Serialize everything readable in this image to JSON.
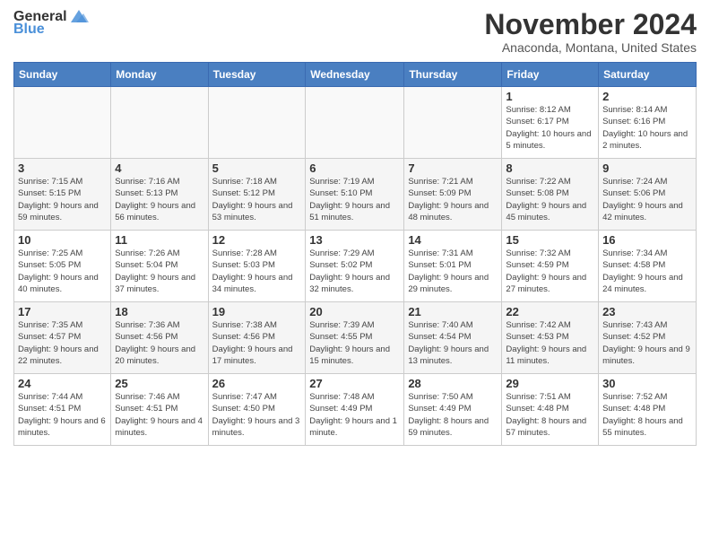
{
  "header": {
    "logo_general": "General",
    "logo_blue": "Blue",
    "month_title": "November 2024",
    "location": "Anaconda, Montana, United States"
  },
  "weekdays": [
    "Sunday",
    "Monday",
    "Tuesday",
    "Wednesday",
    "Thursday",
    "Friday",
    "Saturday"
  ],
  "rows": [
    [
      {
        "day": "",
        "info": ""
      },
      {
        "day": "",
        "info": ""
      },
      {
        "day": "",
        "info": ""
      },
      {
        "day": "",
        "info": ""
      },
      {
        "day": "",
        "info": ""
      },
      {
        "day": "1",
        "info": "Sunrise: 8:12 AM\nSunset: 6:17 PM\nDaylight: 10 hours\nand 5 minutes."
      },
      {
        "day": "2",
        "info": "Sunrise: 8:14 AM\nSunset: 6:16 PM\nDaylight: 10 hours\nand 2 minutes."
      }
    ],
    [
      {
        "day": "3",
        "info": "Sunrise: 7:15 AM\nSunset: 5:15 PM\nDaylight: 9 hours\nand 59 minutes."
      },
      {
        "day": "4",
        "info": "Sunrise: 7:16 AM\nSunset: 5:13 PM\nDaylight: 9 hours\nand 56 minutes."
      },
      {
        "day": "5",
        "info": "Sunrise: 7:18 AM\nSunset: 5:12 PM\nDaylight: 9 hours\nand 53 minutes."
      },
      {
        "day": "6",
        "info": "Sunrise: 7:19 AM\nSunset: 5:10 PM\nDaylight: 9 hours\nand 51 minutes."
      },
      {
        "day": "7",
        "info": "Sunrise: 7:21 AM\nSunset: 5:09 PM\nDaylight: 9 hours\nand 48 minutes."
      },
      {
        "day": "8",
        "info": "Sunrise: 7:22 AM\nSunset: 5:08 PM\nDaylight: 9 hours\nand 45 minutes."
      },
      {
        "day": "9",
        "info": "Sunrise: 7:24 AM\nSunset: 5:06 PM\nDaylight: 9 hours\nand 42 minutes."
      }
    ],
    [
      {
        "day": "10",
        "info": "Sunrise: 7:25 AM\nSunset: 5:05 PM\nDaylight: 9 hours\nand 40 minutes."
      },
      {
        "day": "11",
        "info": "Sunrise: 7:26 AM\nSunset: 5:04 PM\nDaylight: 9 hours\nand 37 minutes."
      },
      {
        "day": "12",
        "info": "Sunrise: 7:28 AM\nSunset: 5:03 PM\nDaylight: 9 hours\nand 34 minutes."
      },
      {
        "day": "13",
        "info": "Sunrise: 7:29 AM\nSunset: 5:02 PM\nDaylight: 9 hours\nand 32 minutes."
      },
      {
        "day": "14",
        "info": "Sunrise: 7:31 AM\nSunset: 5:01 PM\nDaylight: 9 hours\nand 29 minutes."
      },
      {
        "day": "15",
        "info": "Sunrise: 7:32 AM\nSunset: 4:59 PM\nDaylight: 9 hours\nand 27 minutes."
      },
      {
        "day": "16",
        "info": "Sunrise: 7:34 AM\nSunset: 4:58 PM\nDaylight: 9 hours\nand 24 minutes."
      }
    ],
    [
      {
        "day": "17",
        "info": "Sunrise: 7:35 AM\nSunset: 4:57 PM\nDaylight: 9 hours\nand 22 minutes."
      },
      {
        "day": "18",
        "info": "Sunrise: 7:36 AM\nSunset: 4:56 PM\nDaylight: 9 hours\nand 20 minutes."
      },
      {
        "day": "19",
        "info": "Sunrise: 7:38 AM\nSunset: 4:56 PM\nDaylight: 9 hours\nand 17 minutes."
      },
      {
        "day": "20",
        "info": "Sunrise: 7:39 AM\nSunset: 4:55 PM\nDaylight: 9 hours\nand 15 minutes."
      },
      {
        "day": "21",
        "info": "Sunrise: 7:40 AM\nSunset: 4:54 PM\nDaylight: 9 hours\nand 13 minutes."
      },
      {
        "day": "22",
        "info": "Sunrise: 7:42 AM\nSunset: 4:53 PM\nDaylight: 9 hours\nand 11 minutes."
      },
      {
        "day": "23",
        "info": "Sunrise: 7:43 AM\nSunset: 4:52 PM\nDaylight: 9 hours\nand 9 minutes."
      }
    ],
    [
      {
        "day": "24",
        "info": "Sunrise: 7:44 AM\nSunset: 4:51 PM\nDaylight: 9 hours\nand 6 minutes."
      },
      {
        "day": "25",
        "info": "Sunrise: 7:46 AM\nSunset: 4:51 PM\nDaylight: 9 hours\nand 4 minutes."
      },
      {
        "day": "26",
        "info": "Sunrise: 7:47 AM\nSunset: 4:50 PM\nDaylight: 9 hours\nand 3 minutes."
      },
      {
        "day": "27",
        "info": "Sunrise: 7:48 AM\nSunset: 4:49 PM\nDaylight: 9 hours\nand 1 minute."
      },
      {
        "day": "28",
        "info": "Sunrise: 7:50 AM\nSunset: 4:49 PM\nDaylight: 8 hours\nand 59 minutes."
      },
      {
        "day": "29",
        "info": "Sunrise: 7:51 AM\nSunset: 4:48 PM\nDaylight: 8 hours\nand 57 minutes."
      },
      {
        "day": "30",
        "info": "Sunrise: 7:52 AM\nSunset: 4:48 PM\nDaylight: 8 hours\nand 55 minutes."
      }
    ]
  ]
}
